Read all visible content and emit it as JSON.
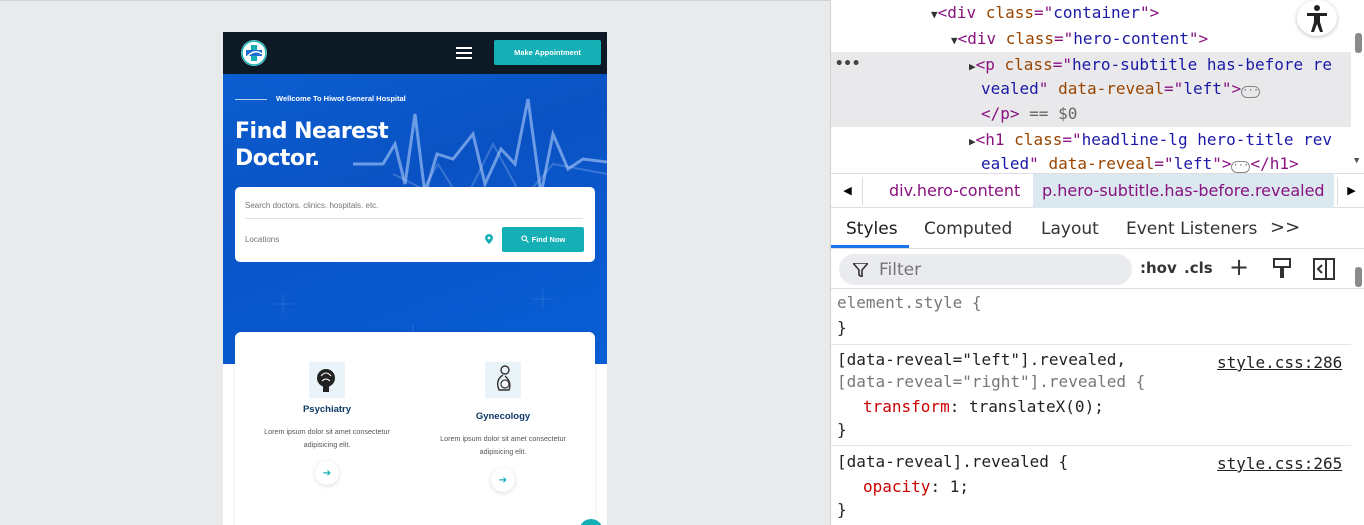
{
  "site": {
    "header": {
      "appointment_label": "Make Appointment"
    },
    "hero": {
      "subtitle": "Wellcome To Hiwot General Hospital",
      "title_line1": "Find Nearest",
      "title_line2": "Doctor."
    },
    "search": {
      "query_placeholder": "Search doctors. clinics. hospitals. etc.",
      "location_placeholder": "Locations",
      "find_label": "Find Now"
    },
    "services": [
      {
        "title": "Psychiatry",
        "desc_line1": "Lorem ipsum dolor sit amet consectetur",
        "desc_line2": "adipisicing elit.",
        "icon": "brain-icon"
      },
      {
        "title": "Gynecology",
        "desc_line1": "Lorem ipsum dolor sit amet consectetur",
        "desc_line2": "adipisicing elit.",
        "icon": "pregnancy-icon"
      }
    ],
    "colors": {
      "teal": "#14b0b6",
      "hero_blue": "#0a52c3",
      "header_dark": "#0d1a26",
      "service_title": "#0d3b66"
    }
  },
  "devtools": {
    "dom": {
      "line1": {
        "tag_open": "<div",
        "attr": "class",
        "eq": "=\"",
        "val": "container",
        "close": "\">"
      },
      "line2": {
        "tag_open": "<div",
        "attr": "class",
        "eq": "=\"",
        "val": "hero-content",
        "close": "\">"
      },
      "line3": {
        "tag_open": "<p",
        "attr": "class",
        "val": "hero-subtitle has-before re"
      },
      "line4": {
        "val": "vealed",
        "attr2": "data-reveal",
        "val2": "left",
        "close": ">"
      },
      "line5": {
        "tag_close": "</p>",
        "eq_text": "== $0"
      },
      "line6": {
        "tag_open": "<h1",
        "attr": "class",
        "val": "headline-lg hero-title rev"
      },
      "line7": {
        "val": "ealed",
        "attr2": "data-reveal",
        "val2": "left",
        "close_tag": "</h1>"
      }
    },
    "breadcrumbs": [
      "div.hero-content",
      "p.hero-subtitle.has-before.revealed"
    ],
    "tabs": [
      "Styles",
      "Computed",
      "Layout",
      "Event Listeners"
    ],
    "more_tabs": ">>",
    "filter_placeholder": "Filter",
    "toolbar": {
      "hov": ":hov",
      "cls": ".cls",
      "plus": "+"
    },
    "rules": [
      {
        "selector": "element.style {",
        "close": "}"
      },
      {
        "selector": "[data-reveal=\"left\"].revealed,",
        "selector2": "[data-reveal=\"right\"].revealed {",
        "prop": "transform",
        "value": "translateX(0);",
        "source": "style.css:286",
        "close": "}"
      },
      {
        "selector": "[data-reveal].revealed {",
        "prop": "opacity",
        "value": "1;",
        "source": "style.css:265",
        "close": "}"
      }
    ]
  }
}
